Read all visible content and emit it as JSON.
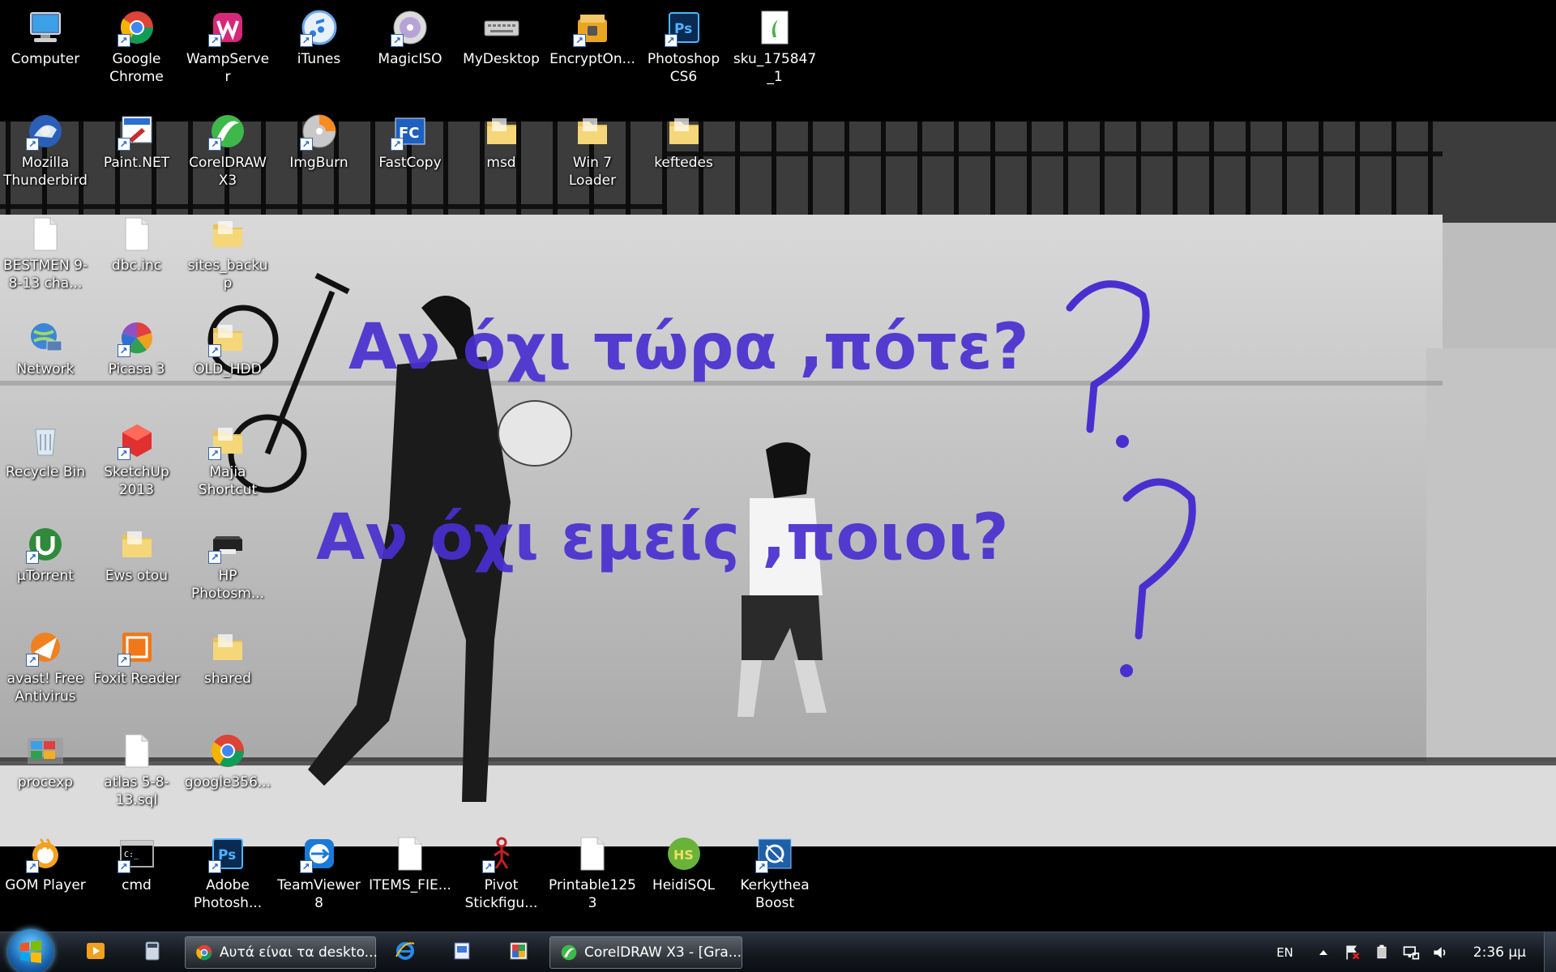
{
  "desktop_icons": [
    {
      "label": "Computer",
      "icon": "computer-icon",
      "shortcut": false
    },
    {
      "label": "Google Chrome",
      "icon": "chrome-icon",
      "shortcut": true
    },
    {
      "label": "WampServer",
      "icon": "wampserver-icon",
      "shortcut": true
    },
    {
      "label": "iTunes",
      "icon": "itunes-icon",
      "shortcut": true
    },
    {
      "label": "MagicISO",
      "icon": "magiciso-icon",
      "shortcut": true
    },
    {
      "label": "MyDesktop",
      "icon": "keyboard-icon",
      "shortcut": false
    },
    {
      "label": "EncryptOn...",
      "icon": "encrypt-lock-icon",
      "shortcut": true
    },
    {
      "label": "Photoshop CS6",
      "icon": "photoshop-icon",
      "shortcut": true
    },
    {
      "label": "sku_175847_1",
      "icon": "image-file-icon",
      "shortcut": false
    },
    {
      "label": "Mozilla Thunderbird",
      "icon": "thunderbird-icon",
      "shortcut": true
    },
    {
      "label": "Paint.NET",
      "icon": "paintnet-icon",
      "shortcut": true
    },
    {
      "label": "CorelDRAW X3",
      "icon": "coreldraw-icon",
      "shortcut": true
    },
    {
      "label": "ImgBurn",
      "icon": "imgburn-icon",
      "shortcut": true
    },
    {
      "label": "FastCopy",
      "icon": "fastcopy-icon",
      "shortcut": true
    },
    {
      "label": "msd",
      "icon": "folder-icon",
      "shortcut": false
    },
    {
      "label": "Win 7 Loader",
      "icon": "folder-icon",
      "shortcut": false
    },
    {
      "label": "keftedes",
      "icon": "folder-icon",
      "shortcut": false
    },
    {
      "label": "BESTMEN 9-8-13 cha...",
      "icon": "document-file-icon",
      "shortcut": false
    },
    {
      "label": "dbc.inc",
      "icon": "document-file-icon",
      "shortcut": false
    },
    {
      "label": "sites_backup",
      "icon": "folder-icon",
      "shortcut": false
    },
    {
      "label": "Network",
      "icon": "network-icon",
      "shortcut": false
    },
    {
      "label": "Picasa 3",
      "icon": "picasa-icon",
      "shortcut": true
    },
    {
      "label": "OLD_HDD",
      "icon": "folder-icon",
      "shortcut": true
    },
    {
      "label": "Recycle Bin",
      "icon": "recycle-bin-icon",
      "shortcut": false
    },
    {
      "label": "SketchUp 2013",
      "icon": "sketchup-icon",
      "shortcut": true
    },
    {
      "label": "Majia Shortcut",
      "icon": "folder-icon",
      "shortcut": true
    },
    {
      "label": "µTorrent",
      "icon": "utorrent-icon",
      "shortcut": true
    },
    {
      "label": "Ews otou",
      "icon": "folder-icon",
      "shortcut": false
    },
    {
      "label": "HP Photosm...",
      "icon": "hp-photosmart-icon",
      "shortcut": true
    },
    {
      "label": "avast! Free Antivirus",
      "icon": "avast-icon",
      "shortcut": true
    },
    {
      "label": "Foxit Reader",
      "icon": "foxit-reader-icon",
      "shortcut": true
    },
    {
      "label": "shared",
      "icon": "folder-icon",
      "shortcut": false
    },
    {
      "label": "procexp",
      "icon": "procexp-icon",
      "shortcut": false
    },
    {
      "label": "atlas 5-8-13.sql",
      "icon": "document-file-icon",
      "shortcut": false
    },
    {
      "label": "google356...",
      "icon": "chrome-icon",
      "shortcut": false
    },
    {
      "label": "GOM Player",
      "icon": "gom-player-icon",
      "shortcut": true
    },
    {
      "label": "cmd",
      "icon": "cmd-icon",
      "shortcut": true
    },
    {
      "label": "Adobe Photosh...",
      "icon": "photoshop-icon",
      "shortcut": true
    },
    {
      "label": "TeamViewer 8",
      "icon": "teamviewer-icon",
      "shortcut": true
    },
    {
      "label": "ITEMS_FIE...",
      "icon": "document-file-icon",
      "shortcut": false
    },
    {
      "label": "Pivot Stickfigu...",
      "icon": "pivot-icon",
      "shortcut": true
    },
    {
      "label": "Printable1253",
      "icon": "document-file-icon",
      "shortcut": false
    },
    {
      "label": "HeidiSQL",
      "icon": "heidisql-icon",
      "shortcut": false
    },
    {
      "label": "Kerkythea Boost",
      "icon": "kerkythea-icon",
      "shortcut": true
    }
  ],
  "wallpaper": {
    "graffiti_line1": "Αν όχι τώρα ,πότε?",
    "graffiti_line2": "Αν όχι εμείς ,ποιοι?",
    "graffiti_color": "#4a2fd0"
  },
  "taskbar": {
    "quick_launch": [
      {
        "icon": "media-player-icon"
      },
      {
        "icon": "calculator-icon"
      }
    ],
    "pinned": [
      {
        "icon": "internet-explorer-icon"
      },
      {
        "icon": "network-scanner-icon"
      },
      {
        "icon": "paint-icon"
      }
    ],
    "windows": [
      {
        "label": "Αυτά είναι τα deskto...",
        "icon": "chrome-icon"
      },
      {
        "label": "CorelDRAW X3 - [Gra...",
        "icon": "coreldraw-icon"
      }
    ],
    "tray": {
      "language": "EN",
      "icons": [
        "show-hidden-icons-chevron",
        "network-error-flag-icon",
        "usb-device-icon",
        "network-connection-icon",
        "volume-icon"
      ],
      "time": "2:36 μμ"
    }
  }
}
